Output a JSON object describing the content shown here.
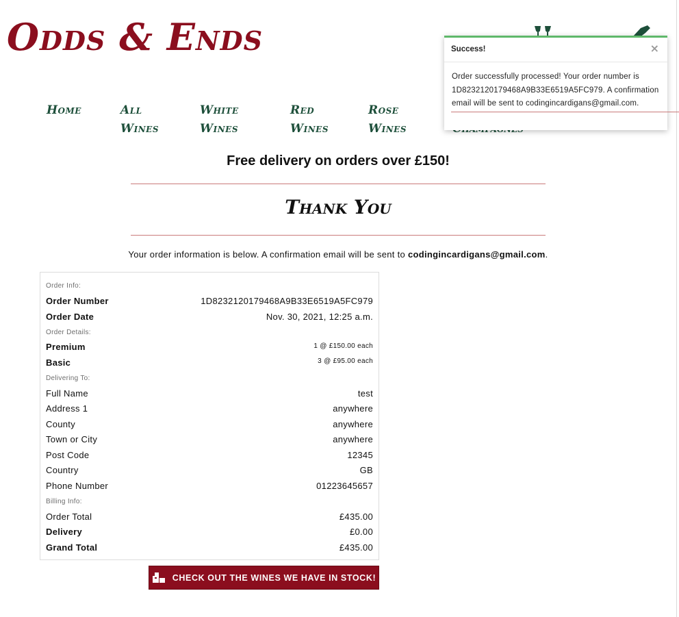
{
  "brand": {
    "logo_text": "Odds & Ends"
  },
  "header": {
    "icons": [
      "wine-glasses-icon",
      "wine-bottle-icon"
    ]
  },
  "nav": {
    "items": [
      {
        "label": "Home"
      },
      {
        "label": "All Wines"
      },
      {
        "label": "White Wines"
      },
      {
        "label": "Red Wines"
      },
      {
        "label": "Rose Wines"
      }
    ]
  },
  "banner": {
    "text": "Free delivery on orders over £150!"
  },
  "page": {
    "title": "Thank You",
    "intro_prefix": "Your order information is below. A confirmation email will be sent to ",
    "intro_email": "codingincardigans@gmail.com",
    "intro_suffix": "."
  },
  "order": {
    "sections": {
      "order_info": "Order Info:",
      "order_details": "Order Details:",
      "delivering_to": "Delivering To:",
      "billing_info": "Billing Info:"
    },
    "order_number_label": "Order Number",
    "order_number": "1D8232120179468A9B33E6519A5FC979",
    "order_date_label": "Order Date",
    "order_date": "Nov. 30, 2021, 12:25 a.m.",
    "items": [
      {
        "name": "Premium",
        "detail": "1 @ £150.00 each"
      },
      {
        "name": "Basic",
        "detail": "3 @ £95.00 each"
      }
    ],
    "delivery": [
      {
        "label": "Full Name",
        "value": "test"
      },
      {
        "label": "Address 1",
        "value": "anywhere"
      },
      {
        "label": "County",
        "value": "anywhere"
      },
      {
        "label": "Town or City",
        "value": "anywhere"
      },
      {
        "label": "Post Code",
        "value": "12345"
      },
      {
        "label": "Country",
        "value": "GB"
      },
      {
        "label": "Phone Number",
        "value": "01223645657"
      }
    ],
    "billing": [
      {
        "label": "Order Total",
        "value": "£435.00"
      },
      {
        "label": "Delivery",
        "value": "£0.00"
      },
      {
        "label": "Grand Total",
        "value": "£435.00"
      }
    ]
  },
  "cta": {
    "label": "CHECK OUT THE WINES WE HAVE IN STOCK!",
    "icon": "boxes-icon"
  },
  "toast": {
    "title": "Success!",
    "close_symbol": "×",
    "message": "Order successfully processed! Your order number is 1D8232120179468A9B33E6519A5FC979. A confirmation email will be sent to codingincardigans@gmail.com."
  },
  "colors": {
    "brand_red": "#8b0e1e",
    "nav_green": "#1d4f3a",
    "success_green": "#5fb86a",
    "rule_red": "#c97a7a"
  }
}
